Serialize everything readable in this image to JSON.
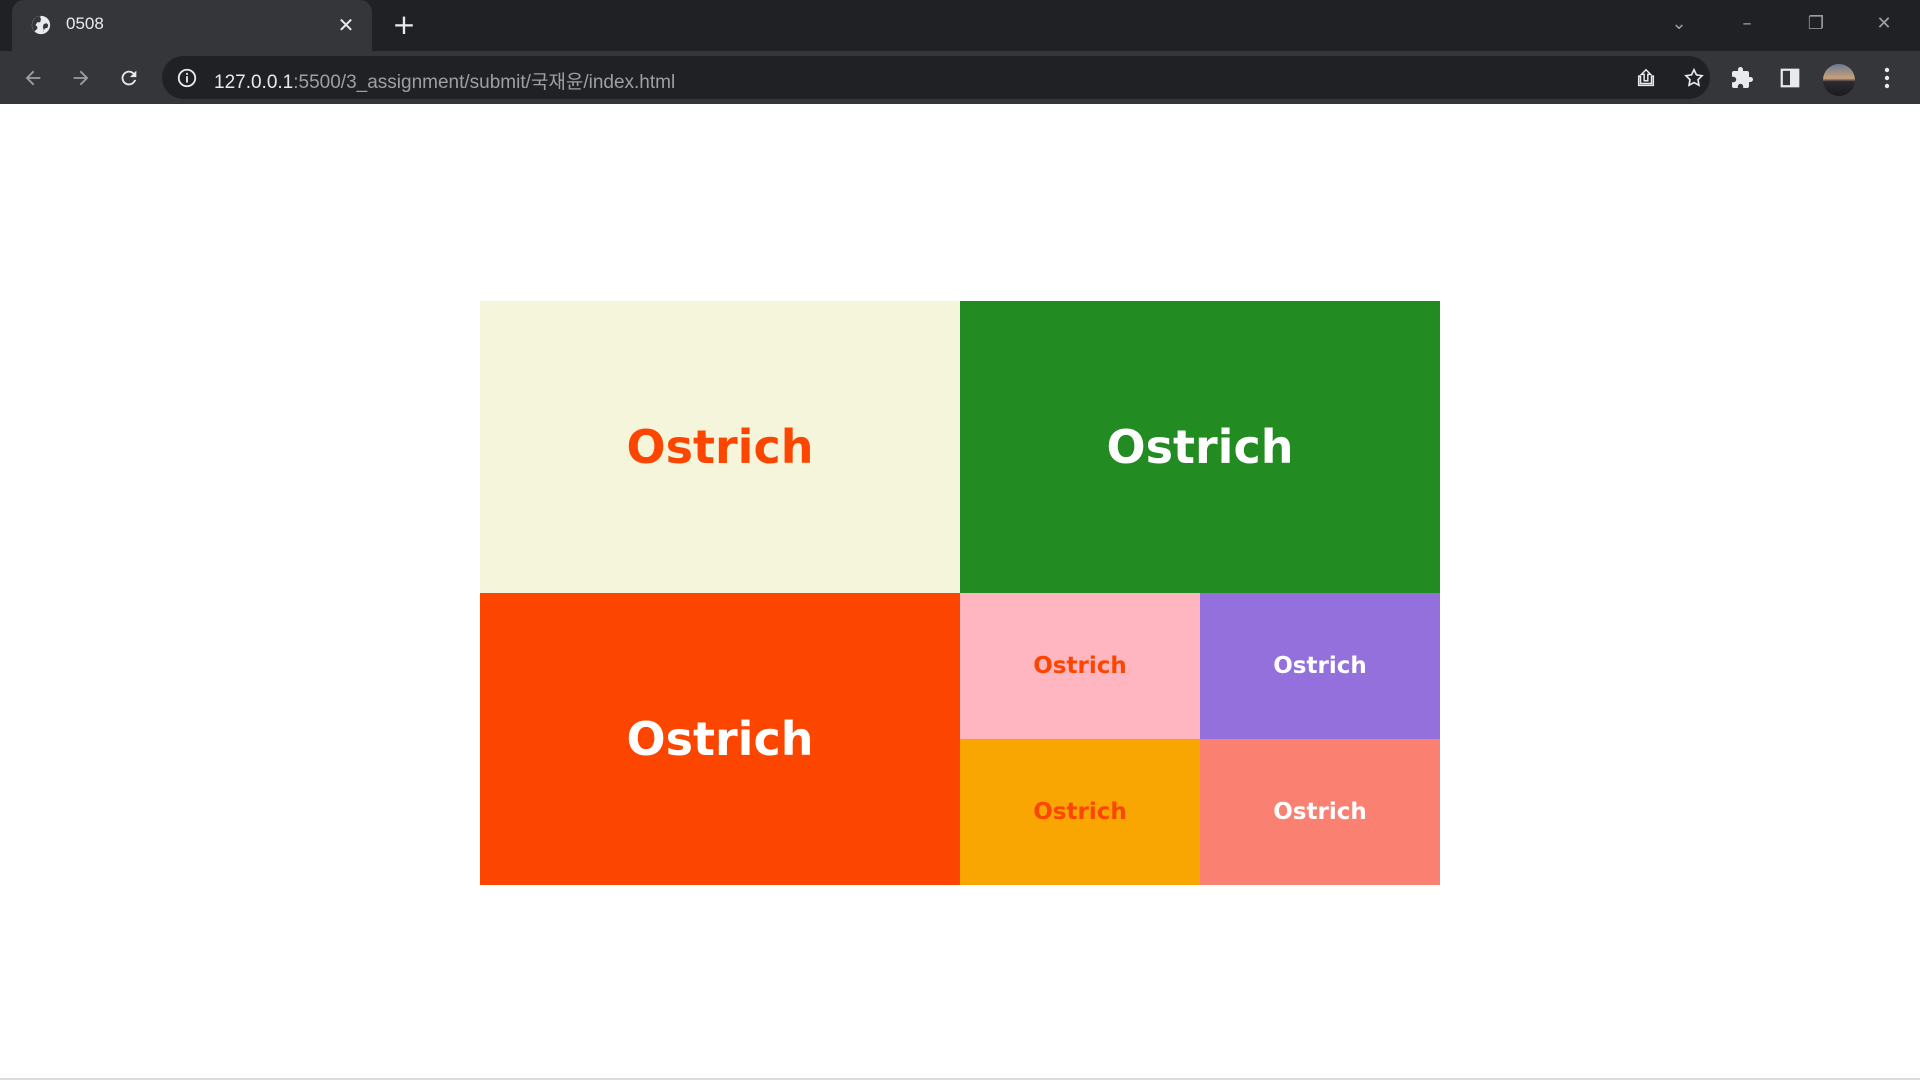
{
  "browser": {
    "tab_title": "0508",
    "url_host": "127.0.0.1",
    "url_rest": ":5500/3_assignment/submit/국재윤/index.html"
  },
  "page": {
    "cells": [
      {
        "text": "Ostrich",
        "background": "#f5f5dc",
        "color": "#fc4600"
      },
      {
        "text": "Ostrich",
        "background": "#228b22",
        "color": "#ffffff"
      },
      {
        "text": "Ostrich",
        "background": "#fc4600",
        "color": "#ffffff"
      },
      {
        "text": "Ostrich",
        "background": "#ffb6c1",
        "color": "#fc4600"
      },
      {
        "text": "Ostrich",
        "background": "#9370db",
        "color": "#ffffff"
      },
      {
        "text": "Ostrich",
        "background": "#f9a602",
        "color": "#fc4600"
      },
      {
        "text": "Ostrich",
        "background": "#fa8072",
        "color": "#ffffff"
      }
    ]
  }
}
